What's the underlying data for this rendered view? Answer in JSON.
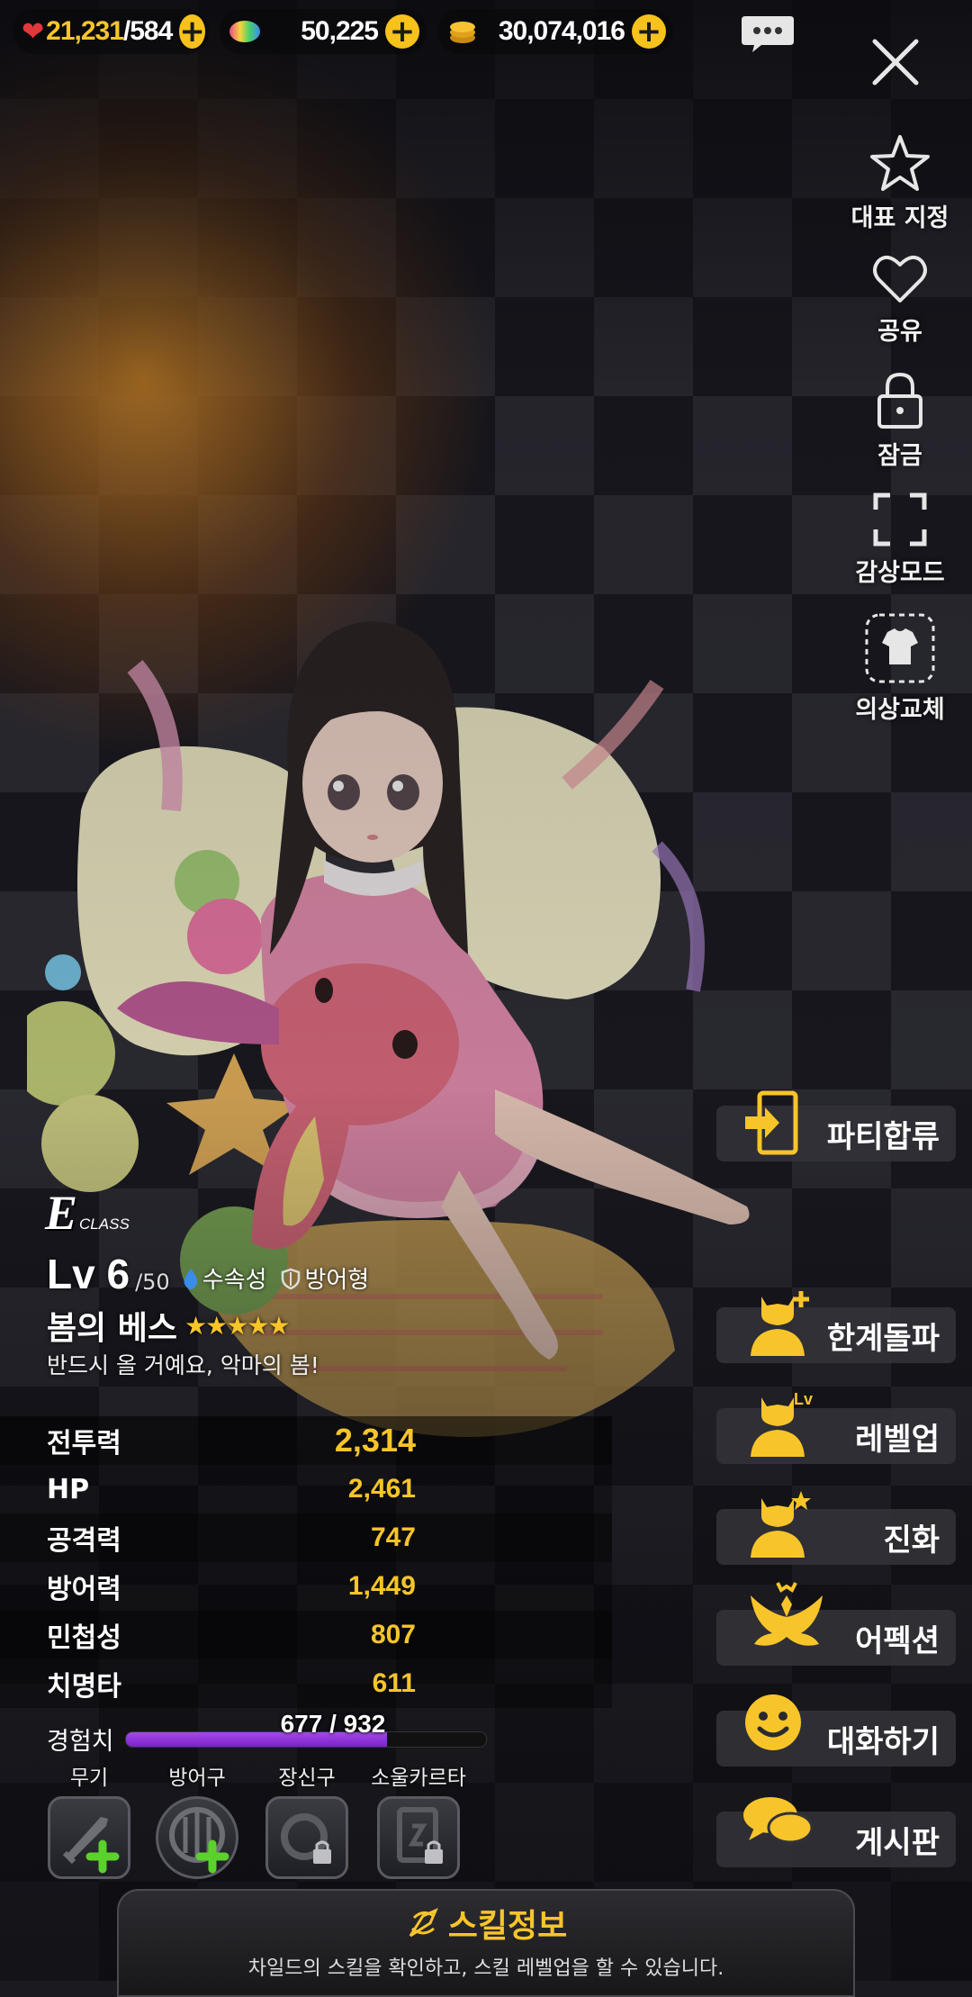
{
  "resources": {
    "stamina": {
      "current": "21,231",
      "separator": "/",
      "max": "584",
      "icon": "heart-icon"
    },
    "gems": {
      "value": "50,225",
      "icon": "rainbow-gem-icon"
    },
    "gold": {
      "value": "30,074,016",
      "icon": "gold-coin-icon"
    },
    "plus_label": "+"
  },
  "side_menu": {
    "representative": "대표 지정",
    "share": "공유",
    "lock": "잠금",
    "view_mode": "감상모드",
    "costume": "의상교체"
  },
  "character": {
    "class_letter": "E",
    "class_label": "CLASS",
    "level_prefix": "Lv",
    "level": "6",
    "level_max": "/50",
    "element": "수속성",
    "role": "방어형",
    "name": "봄의 베스",
    "stars": "★★★★★",
    "star_count": 5,
    "quote": "반드시 올 거예요, 악마의 봄!"
  },
  "stats": [
    {
      "label": "전투력",
      "value": "2,314"
    },
    {
      "label": "HP",
      "value": "2,461"
    },
    {
      "label": "공격력",
      "value": "747"
    },
    {
      "label": "방어력",
      "value": "1,449"
    },
    {
      "label": "민첩성",
      "value": "807"
    },
    {
      "label": "치명타",
      "value": "611"
    }
  ],
  "experience": {
    "label": "경험치",
    "text": "677 / 932",
    "current": 677,
    "max": 932,
    "fill_color": "#9b3fe6"
  },
  "equipment": [
    {
      "label": "무기",
      "state": "add"
    },
    {
      "label": "방어구",
      "state": "add"
    },
    {
      "label": "장신구",
      "state": "locked"
    },
    {
      "label": "소울카르타",
      "state": "locked"
    }
  ],
  "actions": {
    "party": "파티합류",
    "limit_break": "한계돌파",
    "level_up": "레벨업",
    "evolution": "진화",
    "affection": "어펙션",
    "talk": "대화하기",
    "board": "게시판"
  },
  "skill_panel": {
    "title": "스킬정보",
    "description": "차일드의 스킬을 확인하고, 스킬 레벨업을 할 수 있습니다."
  },
  "colors": {
    "accent": "#f7c52a",
    "exp_bar": "#9b3fe6",
    "button_bg": "#323238"
  }
}
